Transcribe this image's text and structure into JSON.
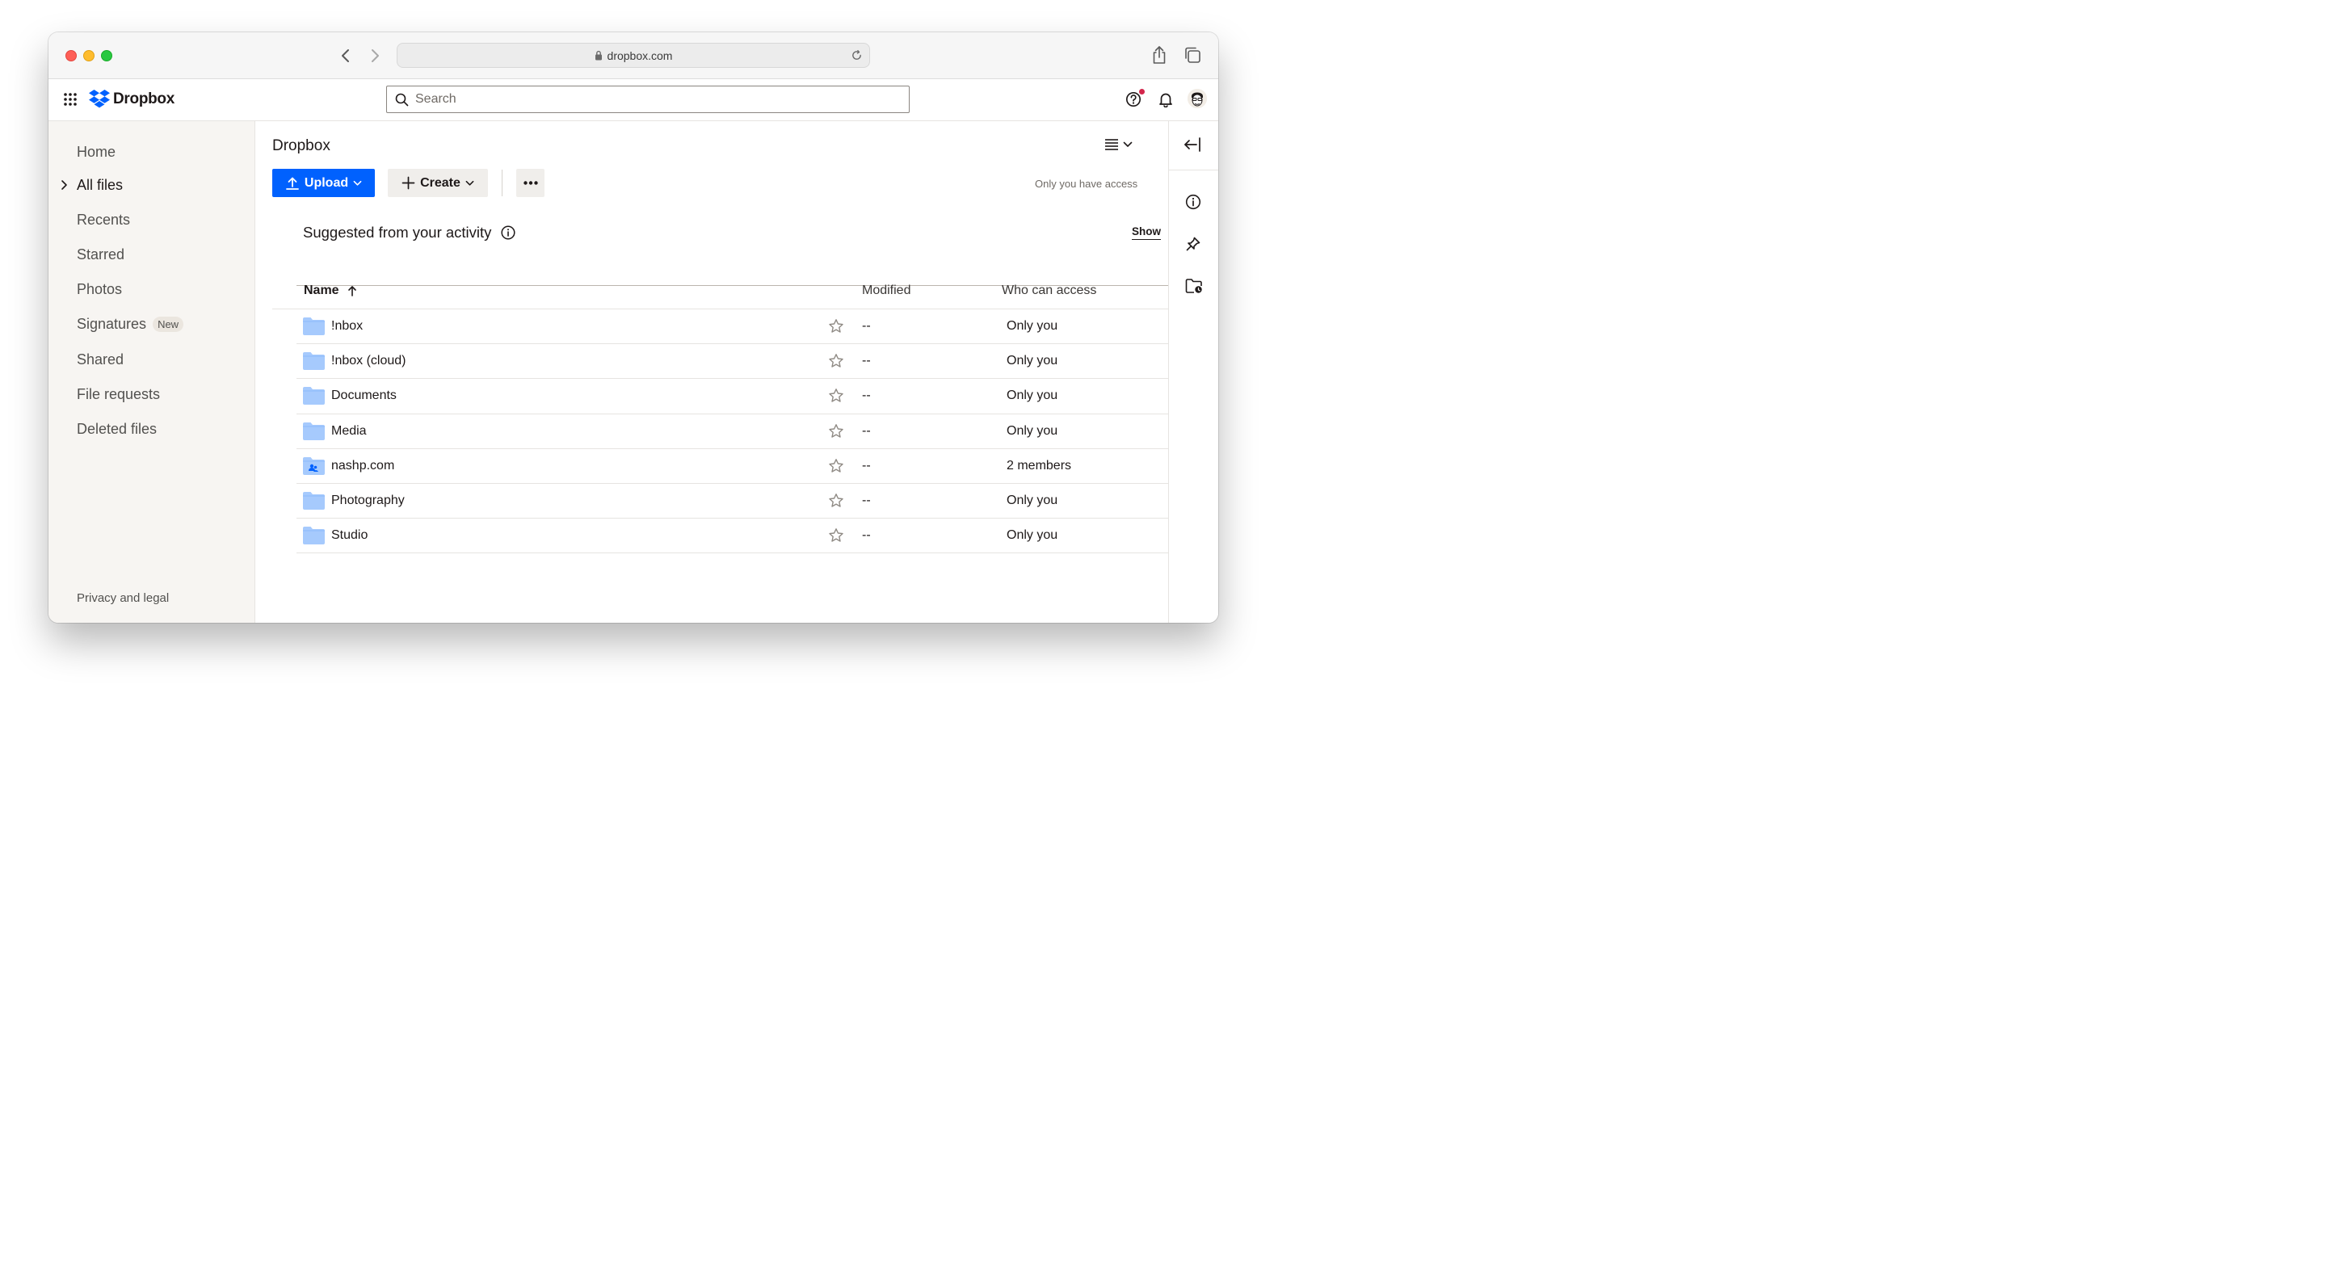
{
  "browser": {
    "url": "dropbox.com"
  },
  "header": {
    "logo_text": "Dropbox",
    "search_placeholder": "Search"
  },
  "sidebar": {
    "items": [
      {
        "label": "Home"
      },
      {
        "label": "All files"
      },
      {
        "label": "Recents"
      },
      {
        "label": "Starred"
      },
      {
        "label": "Photos"
      },
      {
        "label": "Signatures",
        "badge": "New"
      },
      {
        "label": "Shared"
      },
      {
        "label": "File requests"
      },
      {
        "label": "Deleted files"
      }
    ],
    "footer": "Privacy and legal"
  },
  "main": {
    "breadcrumb": "Dropbox",
    "upload_label": "Upload",
    "create_label": "Create",
    "access_note": "Only you have access",
    "suggested_title": "Suggested from your activity",
    "suggested_show": "Show",
    "columns": {
      "name": "Name",
      "modified": "Modified",
      "access": "Who can access"
    },
    "rows": [
      {
        "name": "!nbox",
        "modified": "--",
        "access": "Only you",
        "shared": false
      },
      {
        "name": "!nbox (cloud)",
        "modified": "--",
        "access": "Only you",
        "shared": false
      },
      {
        "name": "Documents",
        "modified": "--",
        "access": "Only you",
        "shared": false
      },
      {
        "name": "Media",
        "modified": "--",
        "access": "Only you",
        "shared": false
      },
      {
        "name": "nashp.com",
        "modified": "--",
        "access": "2 members",
        "shared": true
      },
      {
        "name": "Photography",
        "modified": "--",
        "access": "Only you",
        "shared": false
      },
      {
        "name": "Studio",
        "modified": "--",
        "access": "Only you",
        "shared": false
      }
    ]
  },
  "colors": {
    "accent": "#0061fe",
    "folder": "#a6cafd",
    "notification_dot": "#d3264b"
  }
}
